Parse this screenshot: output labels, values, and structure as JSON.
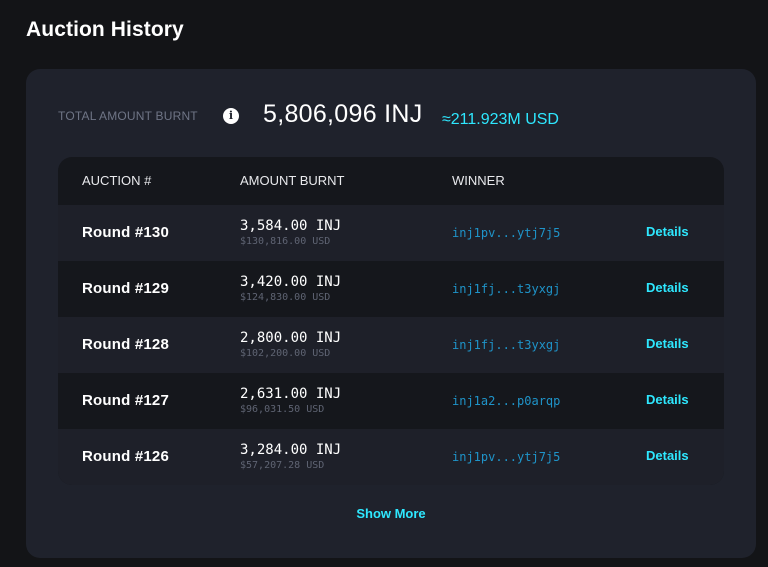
{
  "page": {
    "title": "Auction History"
  },
  "summary": {
    "total_label": "TOTAL AMOUNT BURNT",
    "info_icon": "info-icon",
    "total_value": "5,806,096 INJ",
    "total_usd": "≈211.923M USD"
  },
  "table": {
    "headers": [
      "AUCTION #",
      "AMOUNT BURNT",
      "WINNER"
    ],
    "rows": [
      {
        "round": "Round #130",
        "amount": "3,584.00 INJ",
        "usd": "$130,816.00 USD",
        "winner": "inj1pv...ytj7j5",
        "action": "Details"
      },
      {
        "round": "Round #129",
        "amount": "3,420.00 INJ",
        "usd": "$124,830.00 USD",
        "winner": "inj1fj...t3yxgj",
        "action": "Details"
      },
      {
        "round": "Round #128",
        "amount": "2,800.00 INJ",
        "usd": "$102,200.00 USD",
        "winner": "inj1fj...t3yxgj",
        "action": "Details"
      },
      {
        "round": "Round #127",
        "amount": "2,631.00 INJ",
        "usd": "$96,031.50 USD",
        "winner": "inj1a2...p0arqp",
        "action": "Details"
      },
      {
        "round": "Round #126",
        "amount": "3,284.00 INJ",
        "usd": "$57,207.28 USD",
        "winner": "inj1pv...ytj7j5",
        "action": "Details"
      }
    ]
  },
  "show_more_label": "Show More",
  "colors": {
    "background": "#131417",
    "panel": "#1f222c",
    "accent": "#2ee8ff",
    "link": "#1f94c9"
  }
}
